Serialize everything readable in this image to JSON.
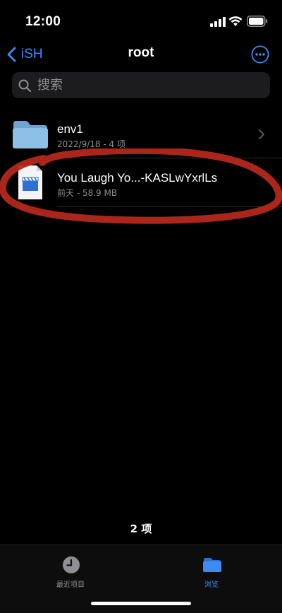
{
  "status_bar": {
    "time": "12:00"
  },
  "nav": {
    "back_label": "iSH",
    "title": "root"
  },
  "search": {
    "placeholder": "搜索"
  },
  "files": [
    {
      "name": "env1",
      "meta": "2022/9/18 - 4 项",
      "kind": "folder-icon"
    },
    {
      "name": "You Laugh Yo...-KASLwYxrlLs",
      "meta": "前天 - 58.9 MB",
      "kind": "video-file-icon"
    }
  ],
  "footer": {
    "item_count": "2 项"
  },
  "tabs": [
    {
      "label": "最近项目",
      "icon": "clock-icon",
      "active": false
    },
    {
      "label": "浏览",
      "icon": "folder-icon",
      "active": true
    }
  ],
  "colors": {
    "accent": "#3d8bf7",
    "background": "#000000",
    "secondary_text": "#8e8e93",
    "annotation": "#b3281c"
  }
}
